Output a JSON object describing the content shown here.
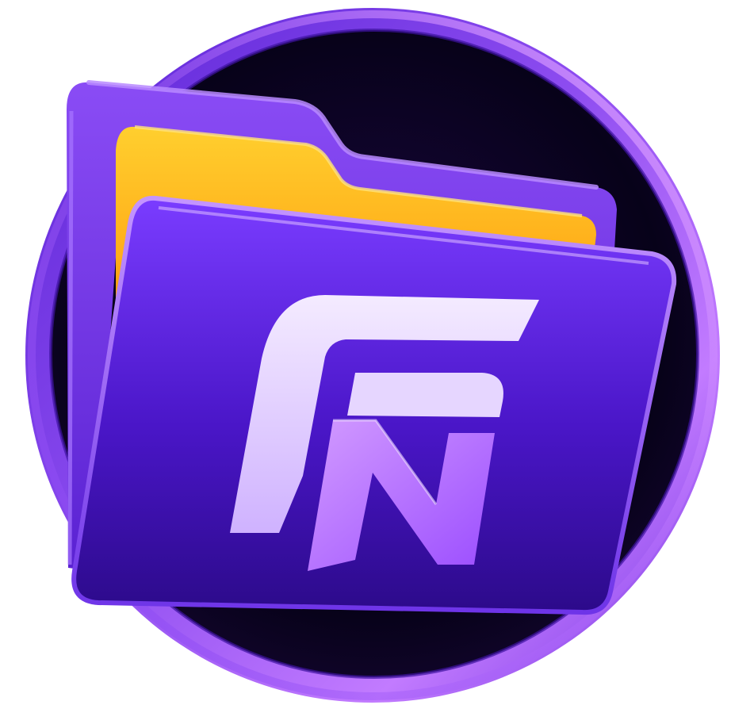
{
  "logo": {
    "name": "file-manager-app-logo",
    "monogram": "FN",
    "icon": "folder-icon"
  },
  "colors": {
    "ring_outer": "#8d4cf0",
    "ring_highlight": "#d08cff",
    "disc_dark": "#070219",
    "back_folder": "#7a3cf0",
    "back_folder_edge": "#b27bff",
    "paper": "#ffc21f",
    "paper_shadow": "#f08a00",
    "front_folder_top": "#7a3cff",
    "front_folder_bottom": "#2c0a8a",
    "letter_light": "#f1e6ff",
    "letter_purple": "#b06dff"
  }
}
